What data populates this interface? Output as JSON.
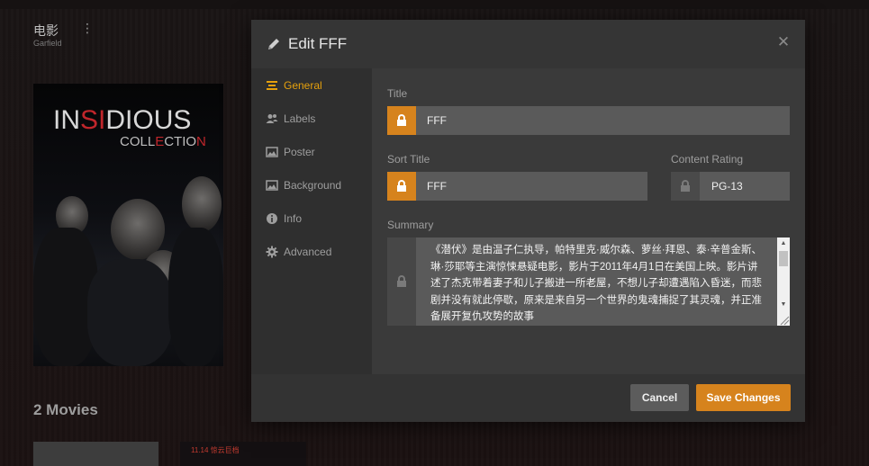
{
  "library": {
    "title": "电影",
    "subtitle": "Garfield",
    "more_glyph": "⋮",
    "poster": {
      "title_pre": "IN",
      "title_red": "SI",
      "title_post": "DIOUS",
      "sub_pre": "COLL",
      "sub_red": "E",
      "sub_mid": "CTIO",
      "sub_red2": "N"
    },
    "count_label": "2 Movies",
    "thumb2_text": "11.14 惊云巨档"
  },
  "modal": {
    "title": "Edit FFF",
    "close_glyph": "✕",
    "sidebar": {
      "items": [
        {
          "label": "General",
          "icon": "list-icon",
          "active": true
        },
        {
          "label": "Labels",
          "icon": "users-icon",
          "active": false
        },
        {
          "label": "Poster",
          "icon": "image-icon",
          "active": false
        },
        {
          "label": "Background",
          "icon": "image-icon",
          "active": false
        },
        {
          "label": "Info",
          "icon": "info-icon",
          "active": false
        },
        {
          "label": "Advanced",
          "icon": "gear-icon",
          "active": false
        }
      ]
    },
    "fields": {
      "title_label": "Title",
      "title_value": "FFF",
      "sort_title_label": "Sort Title",
      "sort_title_value": "FFF",
      "content_rating_label": "Content Rating",
      "content_rating_value": "PG-13",
      "summary_label": "Summary",
      "summary_value": "《潜伏》是由温子仁执导，帕特里克·威尔森、萝丝·拜恩、泰·辛普金斯、琳·莎耶等主演惊悚悬疑电影，影片于2011年4月1日在美国上映。影片讲述了杰克带着妻子和儿子搬进一所老屋，不想儿子却遭遇陷入昏迷，而悲剧并没有就此停歇，原来是来自另一个世界的鬼魂捕捉了其灵魂，并正准备展开复仇攻势的故事"
    },
    "footer": {
      "cancel_label": "Cancel",
      "save_label": "Save Changes"
    }
  },
  "colors": {
    "accent": "#d6831d",
    "active_nav": "#e5a00d"
  }
}
